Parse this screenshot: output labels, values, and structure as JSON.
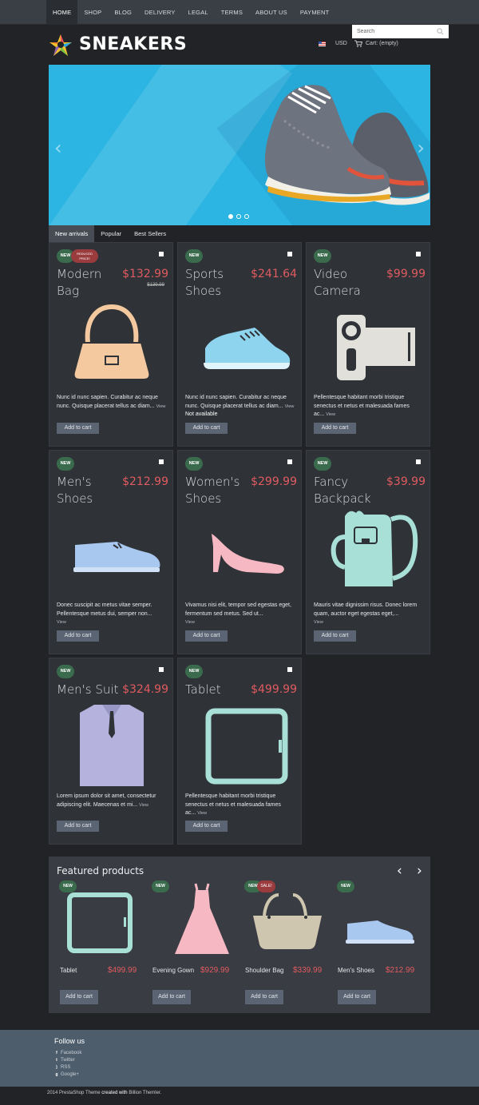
{
  "nav": [
    "HOME",
    "SHOP",
    "BLOG",
    "DELIVERY",
    "LEGAL",
    "TERMS",
    "ABOUT US",
    "PAYMENT"
  ],
  "logo_text": "SNEAKERS",
  "search_placeholder": "Search",
  "currency": "USD",
  "cart": "Cart: (empty)",
  "slider": {
    "prev": "‹",
    "next": "›"
  },
  "tabs": [
    "New arrivals",
    "Popular",
    "Best Sellers"
  ],
  "badge_new": "NEW",
  "badge_reduced": "REDUCED PRICE!",
  "badge_sale": "SALE!",
  "view_label": "View",
  "add_label": "Add to cart",
  "products": [
    {
      "name": "Modern Bag",
      "price": "$132.99",
      "old_price": "$139.99",
      "desc": "Nunc id nunc sapien. Curabitur ac neque nunc. Quisque placerat tellus ac diam...",
      "icon": "bag-icon",
      "color": "#f4c9a0"
    },
    {
      "name": "Sports Shoes",
      "price": "$241.64",
      "desc": "Nunc id nunc sapien. Curabitur ac neque nunc. Quisque placerat tellus ac diam...",
      "avail": "Not available",
      "icon": "sneaker-icon",
      "color": "#8fd4ee"
    },
    {
      "name": "Video Camera",
      "price": "$99.99",
      "desc": "Pellentesque habitant morbi tristique senectus et netus et malesuada fames ac...",
      "icon": "video-camera-icon",
      "color": "#e2e0da"
    },
    {
      "name": "Men's Shoes",
      "price": "$212.99",
      "desc": "Donec suscipit ac metus vitae semper. Pellentesque metus dui, semper non...",
      "icon": "mens-shoe-icon",
      "color": "#a9c8ef"
    },
    {
      "name": "Women's Shoes",
      "price": "$299.99",
      "desc": "Vivamus nisi elit, tempor sed egestas eget, fermentum sed metus. Sed ut...",
      "icon": "heel-icon",
      "color": "#f6b8c3"
    },
    {
      "name": "Fancy Backpack",
      "price": "$39.99",
      "desc": "Mauris vitae dignissim risus. Donec lorem quam, auctor eget egestas eget,...",
      "icon": "backpack-icon",
      "color": "#a8e0d8"
    },
    {
      "name": "Men's Suit",
      "price": "$324.99",
      "desc": "Lorem ipsum dolor sit amet, consectetur adipiscing elit. Maecenas et mi...",
      "icon": "suit-icon",
      "color": "#b5b3de"
    },
    {
      "name": "Tablet",
      "price": "$499.99",
      "desc": "Pellentesque habitant morbi tristique senectus et netus et malesuada fames ac...",
      "icon": "tablet-icon",
      "color": "#a8e0d8"
    }
  ],
  "featured": {
    "title": "Featured products",
    "prev": "‹",
    "next": "›",
    "items": [
      {
        "name": "Tablet",
        "price": "$499.99",
        "icon": "tablet-icon"
      },
      {
        "name": "Evening Gown",
        "price": "$929.99",
        "icon": "dress-icon"
      },
      {
        "name": "Shoulder Bag",
        "price": "$339.99",
        "icon": "shoulder-bag-icon",
        "sale": true
      },
      {
        "name": "Men's Shoes",
        "price": "$212.99",
        "icon": "mens-shoe-icon"
      }
    ]
  },
  "footer": {
    "follow": "Follow us",
    "social": [
      "Facebook",
      "Twitter",
      "RSS",
      "Google+"
    ],
    "copy_year": "2014",
    "copy_brand": "PrestaShop Theme",
    "copy_mid": "created with",
    "copy_by": "Billion Themler",
    "copy_end": "."
  },
  "colors": {
    "accent_price": "#e05b60",
    "new_badge": "#3a6b4d",
    "sale_badge": "#9a3b3e",
    "slider_bg": "#2cb5e2"
  }
}
